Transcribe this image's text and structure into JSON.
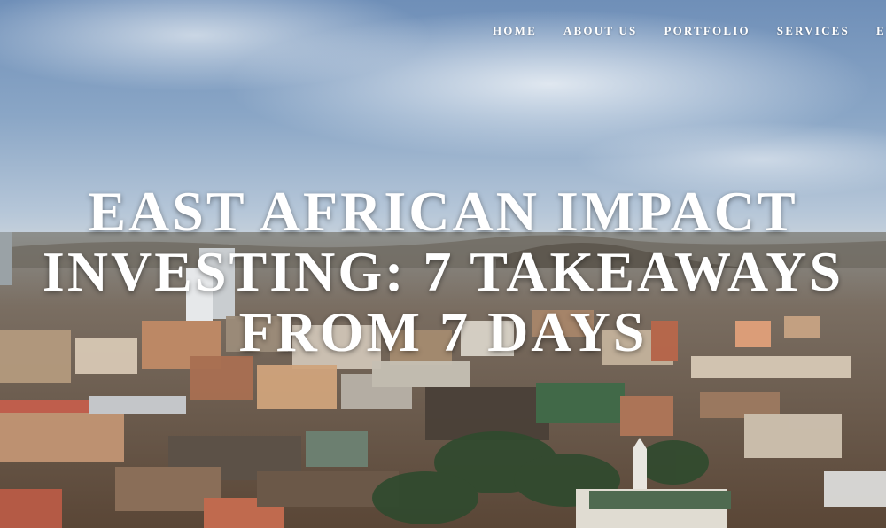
{
  "nav": {
    "items": [
      {
        "label": "HOME"
      },
      {
        "label": "ABOUT US"
      },
      {
        "label": "PORTFOLIO"
      },
      {
        "label": "SERVICES"
      },
      {
        "label": "EV"
      }
    ]
  },
  "hero": {
    "title_lines": [
      "EAST AFRICAN IMPACT",
      "INVESTING: 7 TAKEAWAYS",
      "FROM 7 DAYS"
    ],
    "background": "aerial-city-skyline-photo"
  },
  "colors": {
    "text": "#ffffff",
    "sky_top": "#6f8fb8",
    "city_tone": "#8a6a52"
  }
}
